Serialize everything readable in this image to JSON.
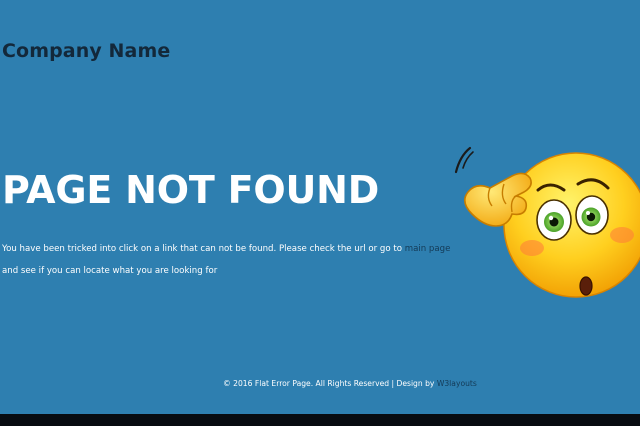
{
  "header": {
    "brand": "Company Name"
  },
  "main": {
    "title": "PAGE NOT FOUND",
    "message_before_link": "You have been tricked into click on a link that can not be found. Please check the url or go to ",
    "link_text": "main page",
    "message_after_link": " and see if you can locate what you are looking for"
  },
  "illustration": {
    "icon": "confused-emoji-icon"
  },
  "footer": {
    "copyright": "© 2016 Flat Error Page. All Rights Reserved | Design by ",
    "designer_link": "W3layouts"
  },
  "colors": {
    "background": "#2e7fb0",
    "brand_text": "#13283a",
    "link": "#143a56",
    "bottom_bar": "#070b10"
  }
}
